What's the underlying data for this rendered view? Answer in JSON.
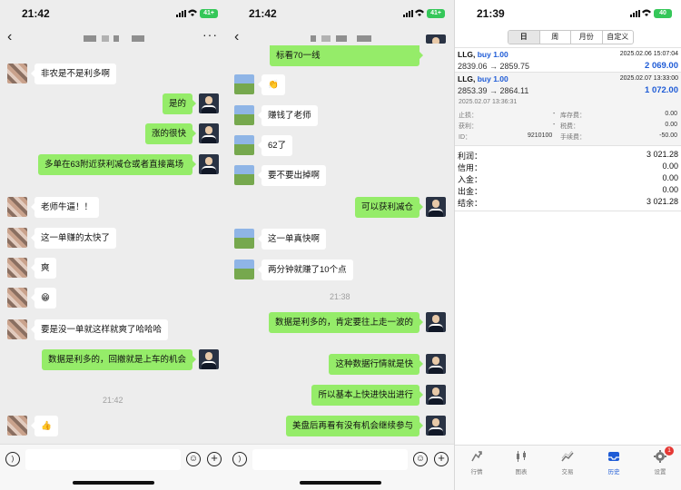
{
  "panel1": {
    "time": "21:42",
    "battery": "41+",
    "messages": [
      {
        "dir": "in",
        "text": "非农是不是利多啊"
      },
      {
        "dir": "out",
        "text": "是的"
      },
      {
        "dir": "out",
        "text": "涨的很快"
      },
      {
        "dir": "out",
        "text": "多单在63附近获利减仓或者直接离场"
      },
      {
        "dir": "in",
        "text": "老师牛逼！！"
      },
      {
        "dir": "in",
        "text": "这一单赚的太快了"
      },
      {
        "dir": "in",
        "text": "爽"
      },
      {
        "dir": "in",
        "text": "😁"
      },
      {
        "dir": "in",
        "text": "要是没一单就这样就爽了哈哈哈"
      },
      {
        "dir": "out",
        "text": "数据是利多的，回撤就是上车的机会"
      },
      {
        "dir": "in",
        "text": "👍"
      }
    ],
    "timestamp": "21:42"
  },
  "panel2": {
    "time": "21:42",
    "battery": "41+",
    "messages": [
      {
        "dir": "out",
        "text": "标看70一线"
      },
      {
        "dir": "in",
        "text": "👏"
      },
      {
        "dir": "in",
        "text": "赚钱了老师"
      },
      {
        "dir": "in",
        "text": "62了"
      },
      {
        "dir": "in",
        "text": "要不要出掉啊"
      },
      {
        "dir": "out",
        "text": "可以获利减仓"
      },
      {
        "dir": "in",
        "text": "这一单真快啊"
      },
      {
        "dir": "in",
        "text": "两分钟就赚了10个点"
      },
      {
        "dir": "out",
        "text": "数据是利多的，肯定要往上走一波的"
      },
      {
        "dir": "out",
        "text": "这种数据行情就是快"
      },
      {
        "dir": "out",
        "text": "所以基本上快进快出进行"
      },
      {
        "dir": "out",
        "text": "美盘后再看有没有机会继续参与"
      }
    ],
    "timestamp": "21:38"
  },
  "panel3": {
    "time": "21:39",
    "battery": "40",
    "tabs": [
      "日",
      "周",
      "月份",
      "自定义"
    ],
    "trades": [
      {
        "symbol": "LLG,",
        "side": "buy 1.00",
        "date": "2025.02.06 15:07:04",
        "prices": "2839.06 → 2859.75",
        "profit": "2 069.00"
      },
      {
        "symbol": "LLG,",
        "side": "buy 1.00",
        "date": "2025.02.07 13:33:00",
        "prices": "2853.39 → 2864.11",
        "profit": "1 072.00"
      }
    ],
    "detail": {
      "date": "2025.02.07 13:36:31",
      "sl_label": "止损：",
      "sl_value": "-",
      "tp_label": "获利：",
      "tp_value": "-",
      "id_label": "ID：",
      "id_value": "9210100",
      "swap_label": "库存费：",
      "swap_value": "0.00",
      "tax_label": "税费：",
      "tax_value": "0.00",
      "fee_label": "手续费：",
      "fee_value": "-50.00"
    },
    "summary": [
      {
        "label": "利润：",
        "value": "3 021.28"
      },
      {
        "label": "信用：",
        "value": "0.00"
      },
      {
        "label": "入金：",
        "value": "0.00"
      },
      {
        "label": "出金：",
        "value": "0.00"
      },
      {
        "label": "结余：",
        "value": "3 021.28"
      }
    ],
    "nav": [
      "行情",
      "图表",
      "交易",
      "历史",
      "设置"
    ],
    "badge": "1"
  }
}
